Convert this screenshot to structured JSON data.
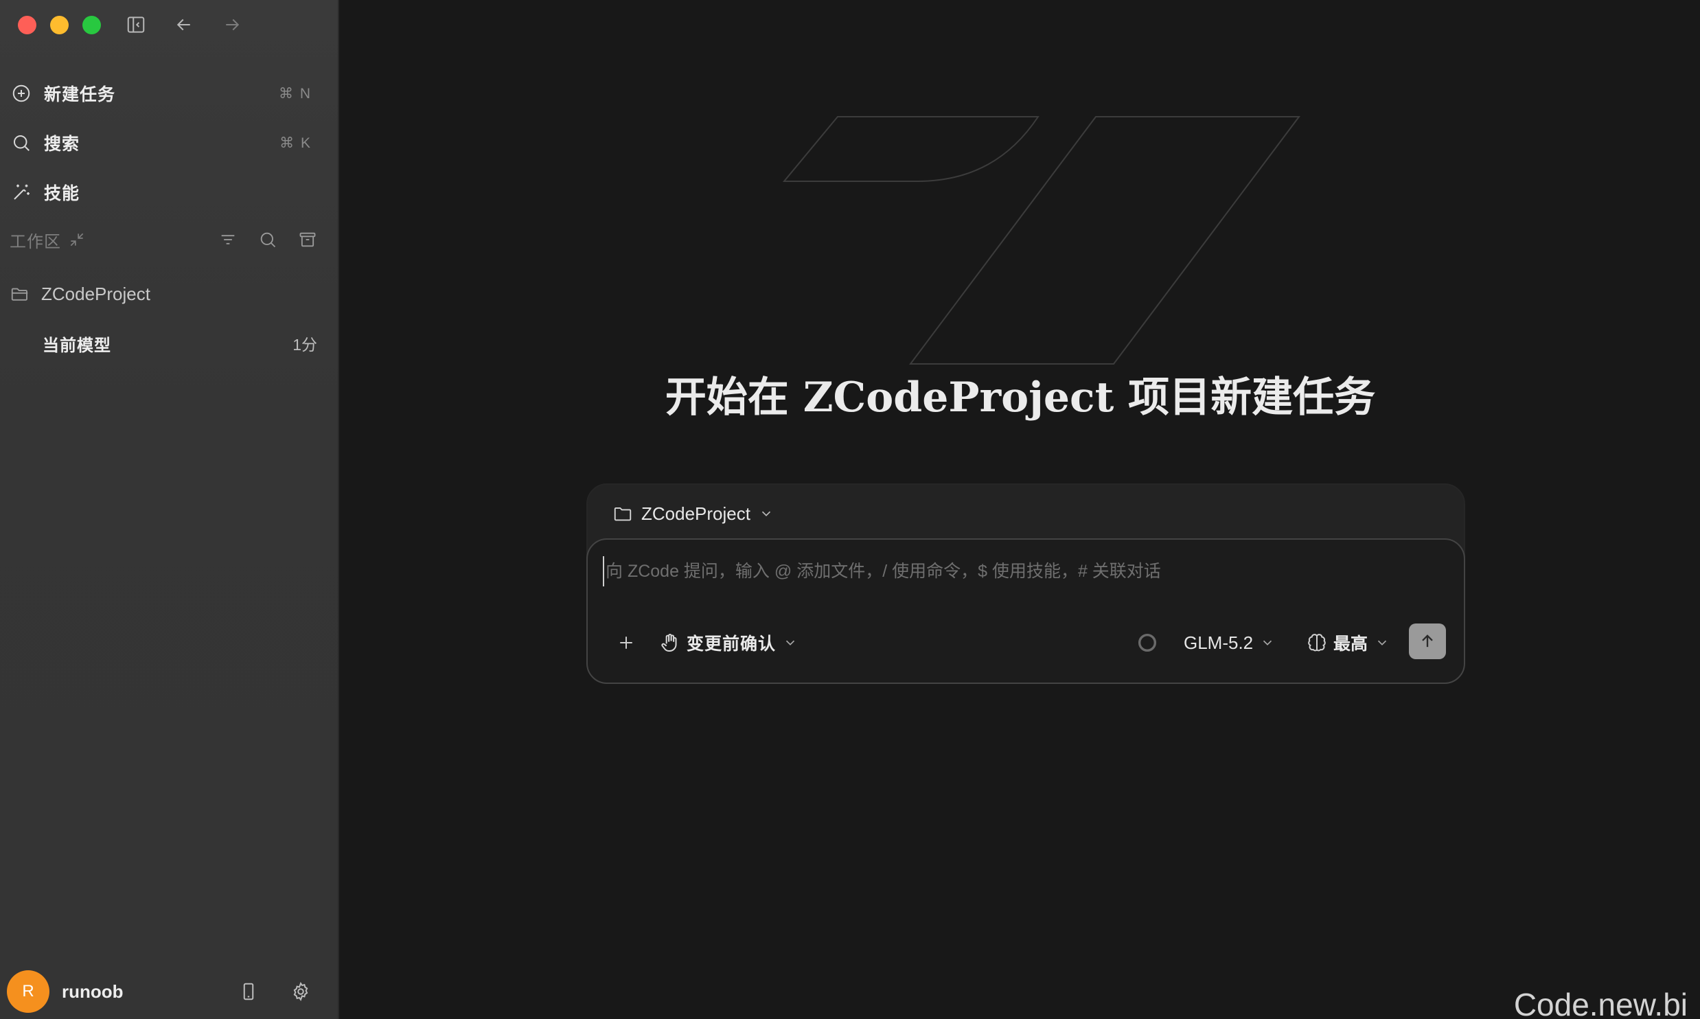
{
  "sidebar": {
    "nav": [
      {
        "label": "新建任务",
        "shortcut": "⌘ N",
        "icon": "plus-circle-icon"
      },
      {
        "label": "搜索",
        "shortcut": "⌘ K",
        "icon": "search-icon"
      },
      {
        "label": "技能",
        "shortcut": "",
        "icon": "magic-wand-icon"
      }
    ],
    "workspace": {
      "title": "工作区",
      "project": "ZCodeProject",
      "tasks": [
        {
          "label": "当前模型",
          "time": "1分"
        }
      ]
    },
    "user": {
      "initial": "R",
      "name": "runoob",
      "avatar_color": "#f5901e"
    }
  },
  "main": {
    "headline": "开始在 ZCodeProject 项目新建任务",
    "composer": {
      "project": "ZCodeProject",
      "placeholder": "向 ZCode 提问，输入 @ 添加文件，/ 使用命令，$ 使用技能，# 关联对话",
      "confirm_mode": "变更前确认",
      "model": "GLM-5.2",
      "reasoning": "最高"
    }
  },
  "watermark": "Code.new.bi",
  "colors": {
    "close": "#fe5f57",
    "minimize": "#febc2e",
    "maximize": "#28c840",
    "background": "#181818",
    "sidebar": "#363636"
  }
}
